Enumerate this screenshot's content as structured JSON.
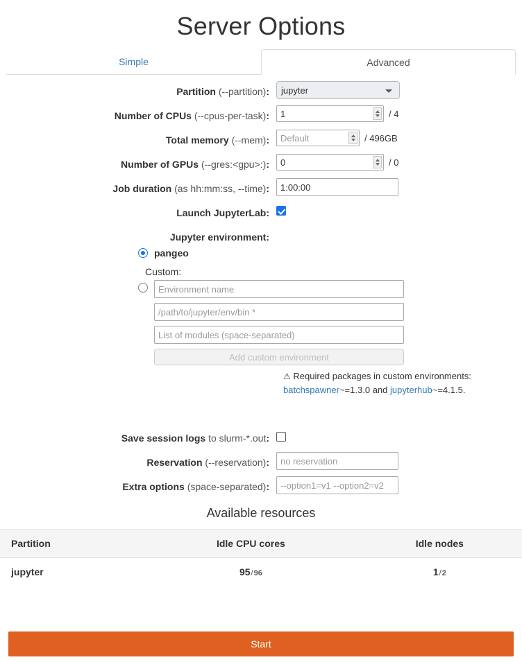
{
  "header": {
    "title": "Server Options"
  },
  "tabs": [
    {
      "label": "Simple",
      "active": false
    },
    {
      "label": "Advanced",
      "active": true
    }
  ],
  "form": {
    "partition": {
      "label_bold": "Partition",
      "label_muted": "(--partition)",
      "colon": ":",
      "value": "jupyter",
      "options": [
        "jupyter"
      ]
    },
    "cpus": {
      "label_bold": "Number of CPUs",
      "label_muted": "(--cpus-per-task)",
      "colon": ":",
      "value": "1",
      "suffix": "/ 4"
    },
    "memory": {
      "label_bold": "Total memory",
      "label_muted": "(--mem)",
      "colon": ":",
      "value": "",
      "placeholder": "Default",
      "suffix": "/ 496GB"
    },
    "gpus": {
      "label_bold": "Number of GPUs",
      "label_muted": "(--gres:<gpu>:)",
      "colon": ":",
      "value": "0",
      "suffix": "/ 0"
    },
    "duration": {
      "label_bold": "Job duration",
      "label_muted": "(as hh:mm:ss, --time)",
      "colon": ":",
      "value": "1:00:00"
    },
    "jupyterlab": {
      "label_bold": "Launch JupyterLab",
      "colon": ":",
      "checked": true
    },
    "environment": {
      "label_bold": "Jupyter environment",
      "colon": ":",
      "selected": "pangeo",
      "preset_option": "pangeo",
      "custom_heading": "Custom:",
      "name_placeholder": "Environment name",
      "path_placeholder": "/path/to/jupyter/env/bin *",
      "modules_placeholder": "List of modules (space-separated)",
      "add_button": "Add custom environment",
      "note_glyph": "⚠",
      "note_text": "Required packages in custom environments:",
      "note_pkg1": "batchspawner",
      "note_pkg1_ver": "~=1.3.0",
      "note_and": "and",
      "note_pkg2": "jupyterhub",
      "note_pkg2_ver": "~=4.1.5."
    },
    "save_logs": {
      "label_bold": "Save session logs",
      "label_muted": "to slurm-*.out",
      "colon": ":",
      "checked": false
    },
    "reservation": {
      "label_bold": "Reservation",
      "label_muted": "(--reservation)",
      "colon": ":",
      "value": "",
      "placeholder": "no reservation"
    },
    "extra_options": {
      "label_bold": "Extra options",
      "label_muted": "(space-separated)",
      "colon": ":",
      "value": "",
      "placeholder": "--option1=v1 --option2=v2"
    }
  },
  "resources": {
    "title": "Available resources",
    "columns": [
      "Partition",
      "Idle CPU cores",
      "Idle nodes"
    ],
    "rows": [
      {
        "partition": "jupyter",
        "idle_cpu_used": "95",
        "idle_cpu_sep": "/",
        "idle_cpu_total": "96",
        "idle_nodes_used": "1",
        "idle_nodes_sep": "/",
        "idle_nodes_total": "2"
      }
    ]
  },
  "footer": {
    "start_label": "Start"
  },
  "colors": {
    "accent_orange": "#df6020",
    "link_blue": "#337ab7",
    "control_blue": "#1a73e8"
  }
}
